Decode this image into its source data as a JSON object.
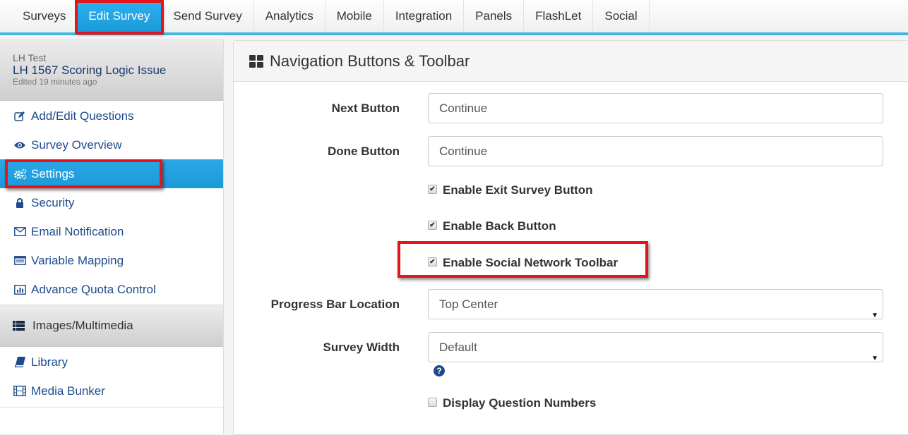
{
  "topnav": {
    "tabs": [
      {
        "label": "Surveys"
      },
      {
        "label": "Edit Survey",
        "active": true
      },
      {
        "label": "Send Survey"
      },
      {
        "label": "Analytics"
      },
      {
        "label": "Mobile"
      },
      {
        "label": "Integration"
      },
      {
        "label": "Panels"
      },
      {
        "label": "FlashLet"
      },
      {
        "label": "Social"
      }
    ]
  },
  "sidebar": {
    "owner": "LH Test",
    "survey_title": "LH 1567 Scoring Logic Issue",
    "edited": "Edited 19 minutes ago",
    "items": [
      {
        "label": "Add/Edit Questions",
        "icon": "edit-icon"
      },
      {
        "label": "Survey Overview",
        "icon": "eye-icon"
      },
      {
        "label": "Settings",
        "icon": "gears-icon",
        "active": true
      },
      {
        "label": "Security",
        "icon": "lock-icon"
      },
      {
        "label": "Email Notification",
        "icon": "envelope-icon"
      },
      {
        "label": "Variable Mapping",
        "icon": "list-alt-icon"
      },
      {
        "label": "Advance Quota Control",
        "icon": "bar-chart-icon"
      }
    ],
    "section2": {
      "label": "Images/Multimedia",
      "icon": "th-list-icon"
    },
    "items2": [
      {
        "label": "Library",
        "icon": "book-icon"
      },
      {
        "label": "Media Bunker",
        "icon": "film-icon"
      }
    ]
  },
  "panel": {
    "title": "Navigation Buttons & Toolbar",
    "next_button": {
      "label": "Next Button",
      "value": "Continue"
    },
    "done_button": {
      "label": "Done Button",
      "value": "Continue"
    },
    "checks": {
      "exit": {
        "label": "Enable Exit Survey Button",
        "checked": true
      },
      "back": {
        "label": "Enable Back Button",
        "checked": true
      },
      "social": {
        "label": "Enable Social Network Toolbar",
        "checked": true
      },
      "numbers": {
        "label": "Display Question Numbers",
        "checked": false
      }
    },
    "progress_bar": {
      "label": "Progress Bar Location",
      "value": "Top Center"
    },
    "survey_width": {
      "label": "Survey Width",
      "value": "Default"
    },
    "help_glyph": "?",
    "check_glyph": "✔"
  },
  "colors": {
    "accent": "#1d99d8",
    "highlight": "#e4141b",
    "link": "#1d4a8c"
  }
}
